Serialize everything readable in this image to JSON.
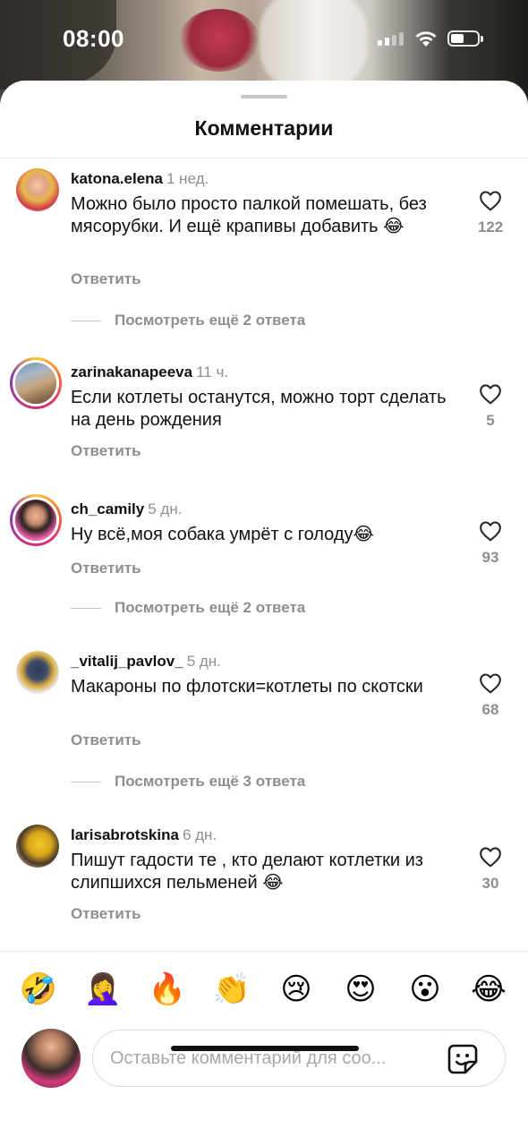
{
  "status": {
    "time": "08:00"
  },
  "sheet": {
    "title": "Комментарии"
  },
  "comments": [
    {
      "user": "katona.elena",
      "ago": "1 нед.",
      "text": "Можно было просто палкой помешать, без мясорубки. И ещё крапивы добавить 😂",
      "reply": "Ответить",
      "likes": "122",
      "more": "Посмотреть ещё 2 ответа"
    },
    {
      "user": "zarinakanapeeva",
      "ago": "11 ч.",
      "text": "Если котлеты останутся, можно торт сделать на день рождения",
      "reply": "Ответить",
      "likes": "5",
      "more": ""
    },
    {
      "user": "ch_camily",
      "ago": "5 дн.",
      "text": "Ну всё,моя собака умрёт с голоду😂",
      "reply": "Ответить",
      "likes": "93",
      "more": "Посмотреть ещё 2 ответа"
    },
    {
      "user": "_vitalij_pavlov_",
      "ago": "5 дн.",
      "text": "Макароны по флотски=котлеты по скотски",
      "reply": "Ответить",
      "likes": "68",
      "more": "Посмотреть ещё 3 ответа"
    },
    {
      "user": "larisabrotskina",
      "ago": "6 дн.",
      "text": "Пишут гадости те , кто делают котлетки из слипшихся пельменей 😂",
      "reply": "Ответить",
      "likes": "30",
      "more": ""
    }
  ],
  "quick_emojis": [
    "🤣",
    "🤦‍♀️",
    "🔥",
    "👏",
    "😢",
    "😍",
    "😮",
    "😂"
  ],
  "composer": {
    "placeholder": "Оставьте комментарий для соо..."
  },
  "icons": {
    "like": "heart-outline-icon",
    "sticker": "sticker-icon",
    "wifi": "wifi-icon",
    "battery": "battery-icon",
    "signal": "cellular-signal-icon"
  },
  "colors": {
    "muted": "#8e8e8e",
    "text": "#111111",
    "story_ring": "#e1306c"
  }
}
